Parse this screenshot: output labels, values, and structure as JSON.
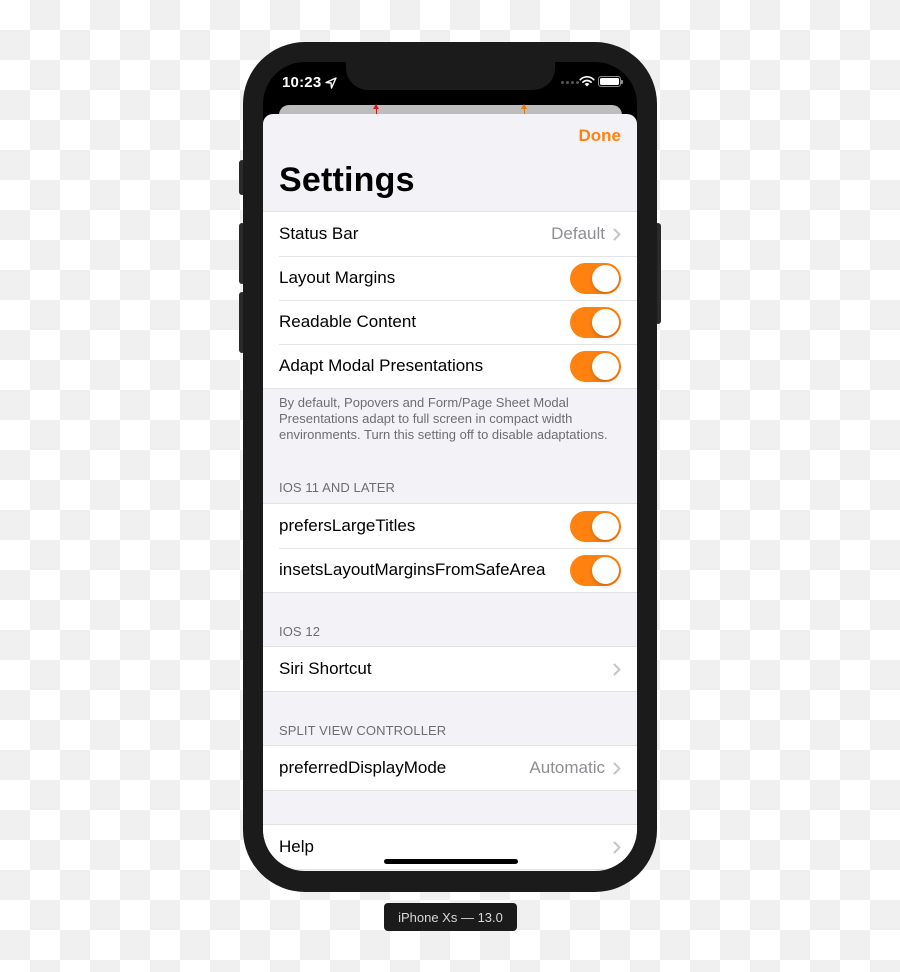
{
  "device": {
    "label": "iPhone Xs — 13.0"
  },
  "status_bar": {
    "time": "10:23",
    "icons": [
      "location-arrow-icon",
      "signal-dots-icon",
      "wifi-icon",
      "battery-icon"
    ]
  },
  "nav": {
    "done_label": "Done",
    "title": "Settings"
  },
  "colors": {
    "accent": "#FF8210",
    "background": "#F2F2F7",
    "secondary_text": "#8E8E93",
    "section_text": "#6D6D72"
  },
  "sections": {
    "general": {
      "cells": [
        {
          "label": "Status Bar",
          "value": "Default",
          "accessory": "chevron"
        },
        {
          "label": "Layout Margins",
          "toggle": true
        },
        {
          "label": "Readable Content",
          "toggle": true
        },
        {
          "label": "Adapt Modal Presentations",
          "toggle": true
        }
      ],
      "footer": "By default, Popovers and Form/Page Sheet Modal Presentations adapt to full screen in compact width environments. Turn this setting off to disable adaptations."
    },
    "ios11": {
      "header": "IOS 11 AND LATER",
      "cells": [
        {
          "label": "prefersLargeTitles",
          "toggle": true
        },
        {
          "label": "insetsLayoutMarginsFromSafeArea",
          "toggle": true
        }
      ]
    },
    "ios12": {
      "header": "IOS 12",
      "cells": [
        {
          "label": "Siri Shortcut",
          "accessory": "chevron"
        }
      ]
    },
    "split_view": {
      "header": "SPLIT VIEW CONTROLLER",
      "cells": [
        {
          "label": "preferredDisplayMode",
          "value": "Automatic",
          "accessory": "chevron"
        }
      ]
    },
    "help": {
      "cells": [
        {
          "label": "Help",
          "accessory": "chevron"
        }
      ]
    }
  }
}
